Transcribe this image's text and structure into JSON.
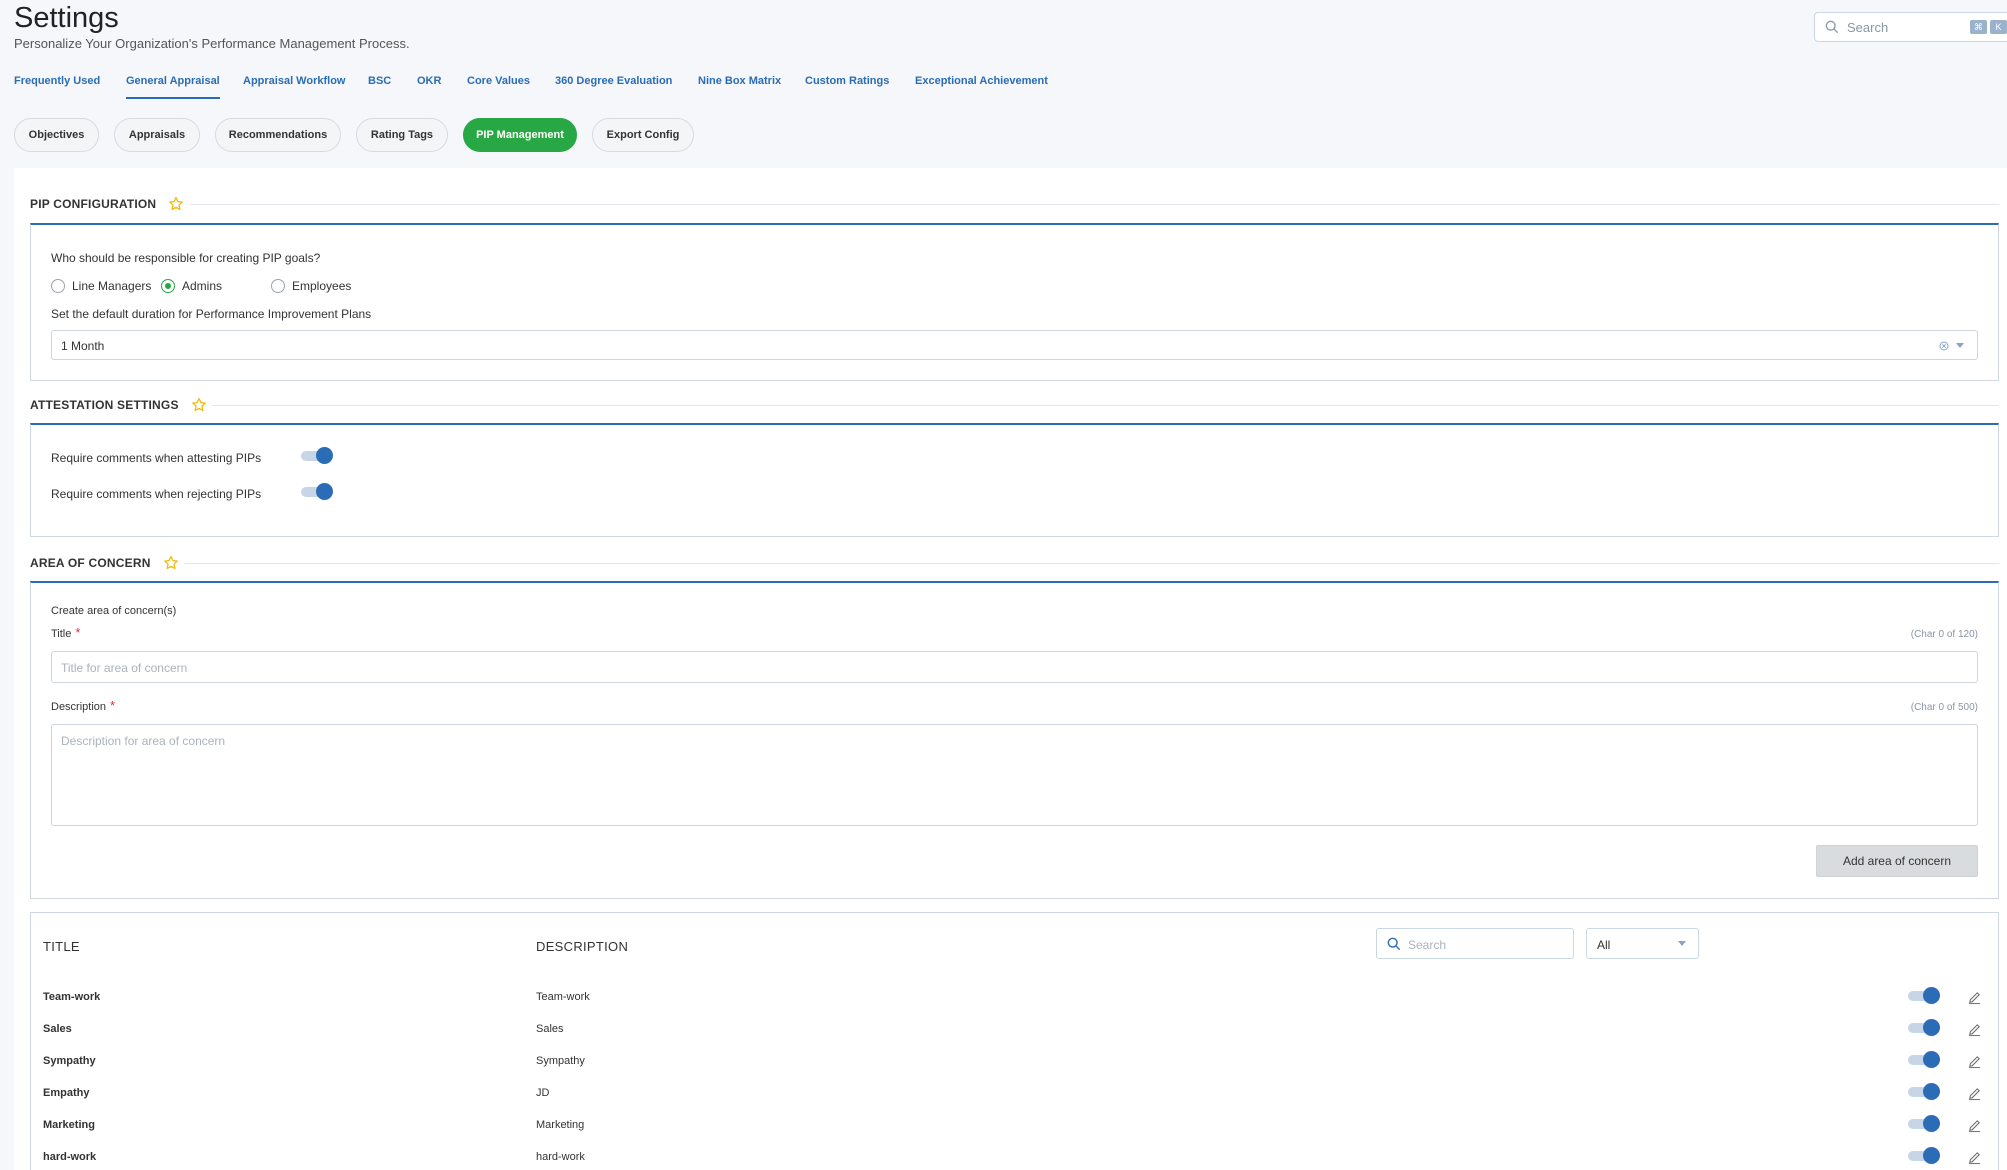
{
  "page": {
    "title": "Settings",
    "subtitle": "Personalize Your Organization's Performance Management Process."
  },
  "global_search": {
    "placeholder": "Search",
    "shortcut_keys": [
      "⌘",
      "K"
    ]
  },
  "tabs": [
    {
      "label": "Frequently Used",
      "active": false
    },
    {
      "label": "General Appraisal",
      "active": true
    },
    {
      "label": "Appraisal Workflow",
      "active": false
    },
    {
      "label": "BSC",
      "active": false
    },
    {
      "label": "OKR",
      "active": false
    },
    {
      "label": "Core Values",
      "active": false
    },
    {
      "label": "360 Degree Evaluation",
      "active": false
    },
    {
      "label": "Nine Box Matrix",
      "active": false
    },
    {
      "label": "Custom Ratings",
      "active": false
    },
    {
      "label": "Exceptional Achievement",
      "active": false
    }
  ],
  "subtabs": [
    {
      "label": "Objectives",
      "active": false
    },
    {
      "label": "Appraisals",
      "active": false
    },
    {
      "label": "Recommendations",
      "active": false
    },
    {
      "label": "Rating Tags",
      "active": false
    },
    {
      "label": "PIP Management",
      "active": true
    },
    {
      "label": "Export Config",
      "active": false
    }
  ],
  "pip_configuration": {
    "heading": "PIP CONFIGURATION",
    "question": "Who should be responsible for creating PIP goals?",
    "options": [
      {
        "label": "Line Managers",
        "selected": false
      },
      {
        "label": "Admins",
        "selected": true
      },
      {
        "label": "Employees",
        "selected": false
      }
    ],
    "duration_label": "Set the default duration for Performance Improvement Plans",
    "duration_value": "1 Month"
  },
  "attestation_settings": {
    "heading": "ATTESTATION SETTINGS",
    "items": [
      {
        "label": "Require comments when attesting PIPs",
        "enabled": true
      },
      {
        "label": "Require comments when rejecting PIPs",
        "enabled": true
      }
    ]
  },
  "area_of_concern": {
    "heading": "AREA OF CONCERN",
    "create_label": "Create area of concern(s)",
    "title_label": "Title",
    "title_counter": "(Char 0 of 120)",
    "title_placeholder": "Title for area of concern",
    "description_label": "Description",
    "description_counter": "(Char 0 of 500)",
    "description_placeholder": "Description for area of concern",
    "add_button": "Add area of concern",
    "required_mark": "*"
  },
  "concern_table": {
    "col_title": "TITLE",
    "col_description": "DESCRIPTION",
    "search_placeholder": "Search",
    "filter_value": "All",
    "rows": [
      {
        "title": "Team-work",
        "description": "Team-work",
        "enabled": true
      },
      {
        "title": "Sales",
        "description": "Sales",
        "enabled": true
      },
      {
        "title": "Sympathy",
        "description": "Sympathy",
        "enabled": true
      },
      {
        "title": "Empathy",
        "description": "JD",
        "enabled": true
      },
      {
        "title": "Marketing",
        "description": "Marketing",
        "enabled": true
      },
      {
        "title": "hard-work",
        "description": "hard-work",
        "enabled": true
      }
    ]
  },
  "colors": {
    "accent_blue": "#2a6cb5",
    "active_green": "#27a844",
    "star_yellow": "#f2b705",
    "required_red": "#d9303d"
  }
}
